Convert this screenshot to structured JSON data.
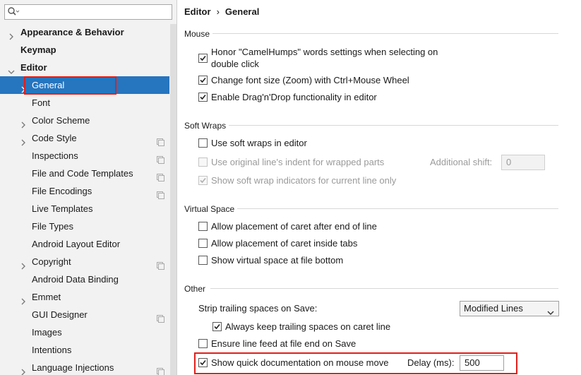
{
  "search": {
    "placeholder": "",
    "value": ""
  },
  "sidebar": {
    "items": [
      {
        "label": "Appearance & Behavior",
        "bold": true,
        "expandable": true,
        "expanded": false
      },
      {
        "label": "Keymap",
        "bold": true,
        "expandable": false
      },
      {
        "label": "Editor",
        "bold": true,
        "expandable": true,
        "expanded": true
      },
      {
        "label": "General",
        "selected": true,
        "expandable": true
      },
      {
        "label": "Font"
      },
      {
        "label": "Color Scheme",
        "expandable": true
      },
      {
        "label": "Code Style",
        "expandable": true,
        "project_icon": true
      },
      {
        "label": "Inspections",
        "project_icon": true
      },
      {
        "label": "File and Code Templates",
        "project_icon": true
      },
      {
        "label": "File Encodings",
        "project_icon": true
      },
      {
        "label": "Live Templates"
      },
      {
        "label": "File Types"
      },
      {
        "label": "Android Layout Editor"
      },
      {
        "label": "Copyright",
        "expandable": true,
        "project_icon": true
      },
      {
        "label": "Android Data Binding"
      },
      {
        "label": "Emmet",
        "expandable": true
      },
      {
        "label": "GUI Designer",
        "project_icon": true
      },
      {
        "label": "Images"
      },
      {
        "label": "Intentions"
      },
      {
        "label": "Language Injections",
        "expandable": true,
        "project_icon": true
      }
    ]
  },
  "breadcrumb": {
    "parent": "Editor",
    "separator": "›",
    "current": "General"
  },
  "sections": {
    "mouse": {
      "title": "Mouse",
      "camelhumps_line1": "Honor \"CamelHumps\" words settings when selecting on",
      "camelhumps_line2": "double click",
      "camelhumps_checked": true,
      "zoom_label": "Change font size (Zoom) with Ctrl+Mouse Wheel",
      "zoom_checked": true,
      "dragdrop_label": "Enable Drag'n'Drop functionality in editor",
      "dragdrop_checked": true
    },
    "soft_wraps": {
      "title": "Soft Wraps",
      "use_soft_wraps_label": "Use soft wraps in editor",
      "use_soft_wraps_checked": false,
      "orig_indent_label": "Use original line's indent for wrapped parts",
      "orig_indent_checked": false,
      "additional_shift_label": "Additional shift:",
      "additional_shift_value": "0",
      "show_indicators_label": "Show soft wrap indicators for current line only",
      "show_indicators_checked": true
    },
    "virtual_space": {
      "title": "Virtual Space",
      "after_end_label": "Allow placement of caret after end of line",
      "inside_tabs_label": "Allow placement of caret inside tabs",
      "file_bottom_label": "Show virtual space at file bottom"
    },
    "other": {
      "title": "Other",
      "strip_label": "Strip trailing spaces on Save:",
      "strip_value": "Modified Lines",
      "keep_trailing_label": "Always keep trailing spaces on caret line",
      "keep_trailing_checked": true,
      "line_feed_label": "Ensure line feed at file end on Save",
      "line_feed_checked": false,
      "quick_doc_label": "Show quick documentation on mouse move",
      "quick_doc_checked": true,
      "delay_label": "Delay (ms):",
      "delay_value": "500"
    }
  },
  "colors": {
    "selection": "#2675bf",
    "highlight_box": "#e0201c"
  }
}
